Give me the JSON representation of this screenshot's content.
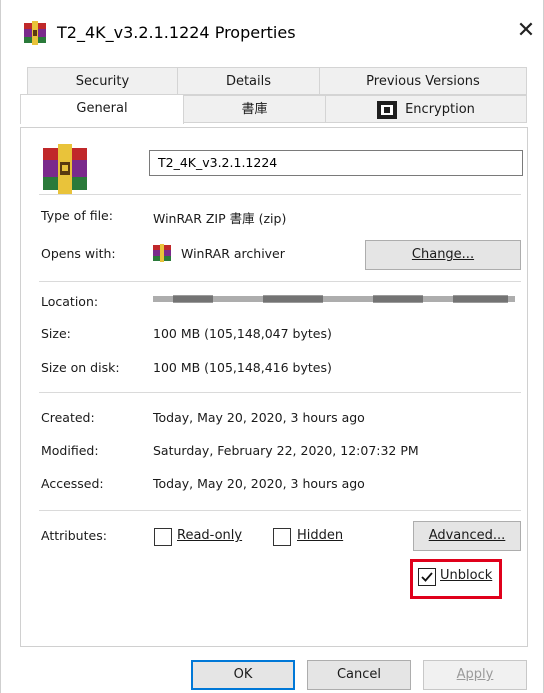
{
  "window": {
    "title": "T2_4K_v3.2.1.1224 Properties",
    "close_glyph": "✕"
  },
  "tabs": {
    "row1": [
      "Security",
      "Details",
      "Previous Versions"
    ],
    "row2": [
      "General",
      "書庫",
      "Encryption"
    ],
    "active": "General"
  },
  "general": {
    "file_name": "T2_4K_v3.2.1.1224",
    "type_label": "Type of file:",
    "type_value": "WinRAR ZIP 書庫 (zip)",
    "opens_label": "Opens with:",
    "opens_value": "WinRAR archiver",
    "change_button": "Change...",
    "location_label": "Location:",
    "size_label": "Size:",
    "size_value": "100 MB (105,148,047 bytes)",
    "size_disk_label": "Size on disk:",
    "size_disk_value": "100 MB (105,148,416 bytes)",
    "created_label": "Created:",
    "created_value": "Today, May 20, 2020, 3 hours ago",
    "modified_label": "Modified:",
    "modified_value": "Saturday, February 22, 2020, 12:07:32 PM",
    "accessed_label": "Accessed:",
    "accessed_value": "Today, May 20, 2020, 3 hours ago",
    "attributes_label": "Attributes:",
    "readonly_label": "Read-only",
    "hidden_label": "Hidden",
    "advanced_button": "Advanced...",
    "unblock_label": "Unblock",
    "unblock_checked": true,
    "readonly_checked": false,
    "hidden_checked": false
  },
  "footer": {
    "ok": "OK",
    "cancel": "Cancel",
    "apply": "Apply"
  },
  "colors": {
    "highlight": "#e0001b",
    "ok_border": "#0078d7"
  },
  "icons": {
    "app": "winrar-icon",
    "file": "winrar-archive-icon",
    "opens": "winrar-small-icon",
    "encryption": "encryption-icon"
  }
}
